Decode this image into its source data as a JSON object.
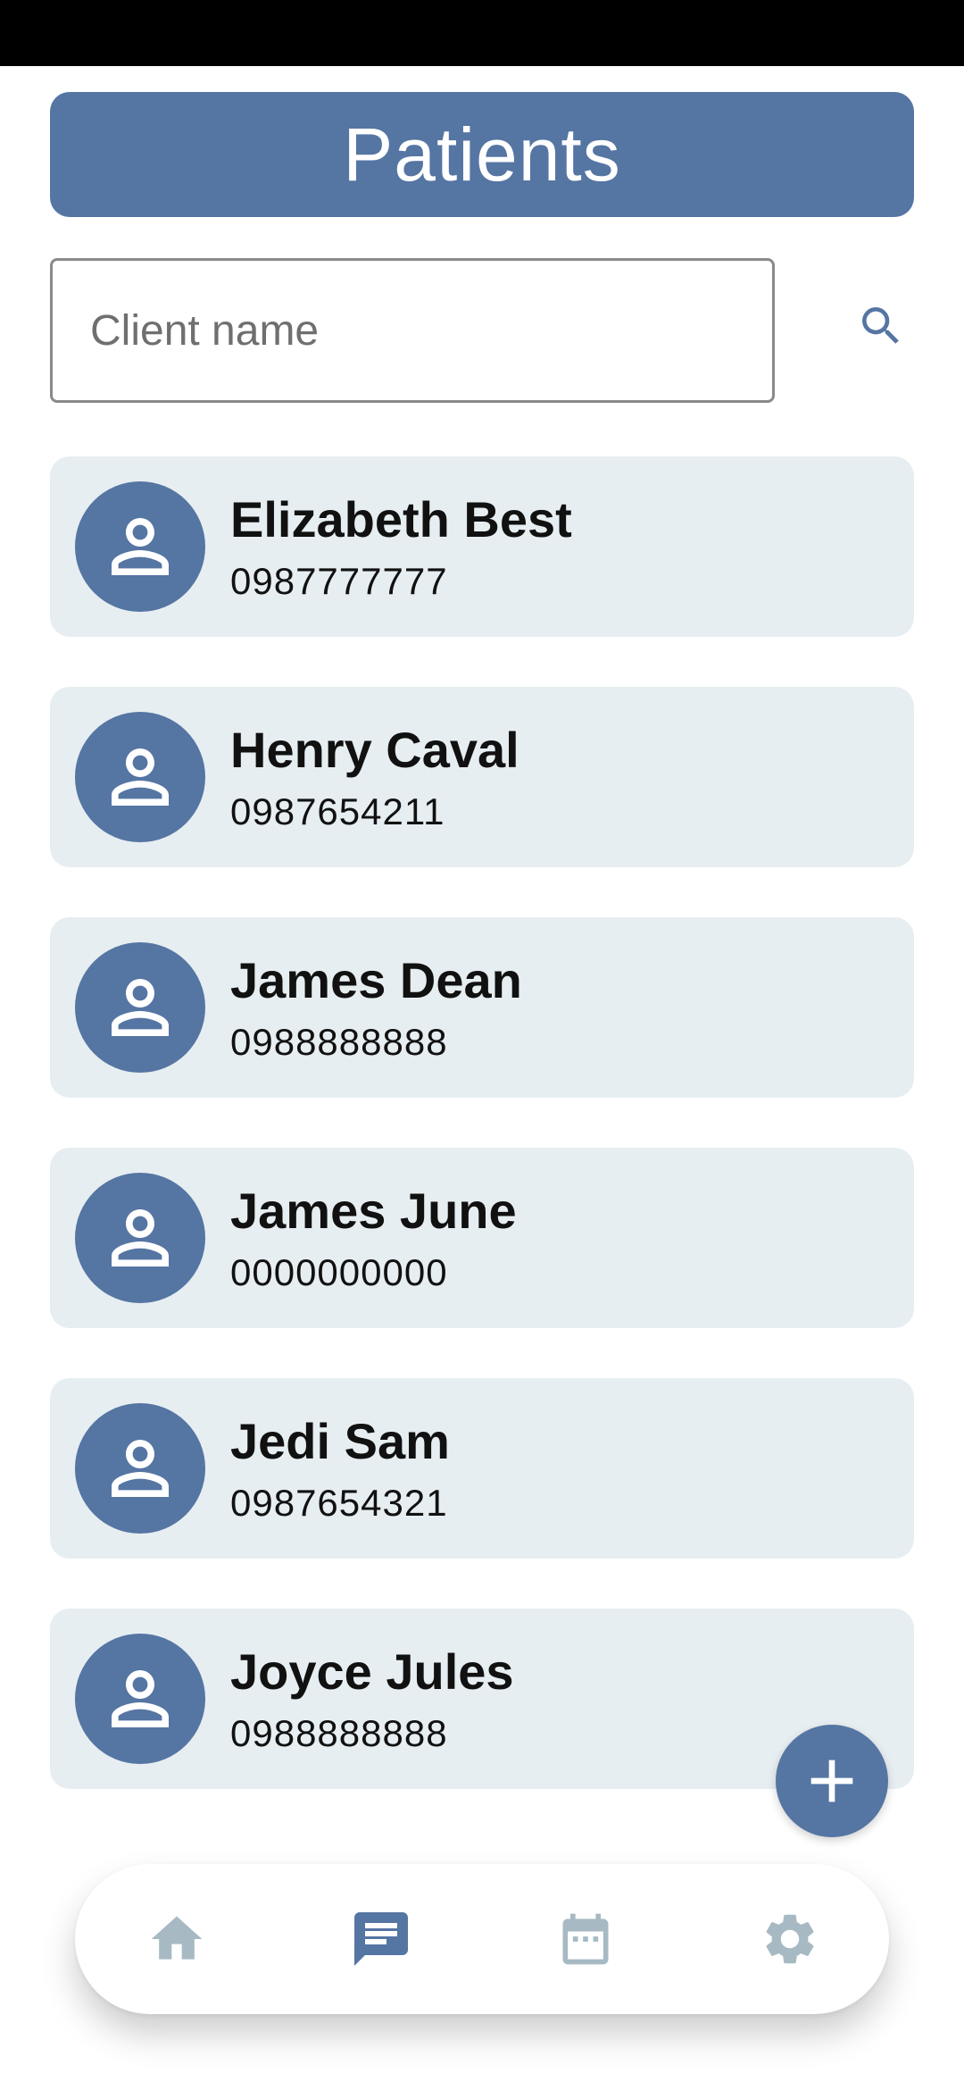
{
  "header": {
    "title": "Patients"
  },
  "search": {
    "placeholder": "Client name",
    "value": ""
  },
  "patients": [
    {
      "name": "Elizabeth Best",
      "phone": "0987777777"
    },
    {
      "name": "Henry Caval",
      "phone": "0987654211"
    },
    {
      "name": "James Dean",
      "phone": "0988888888"
    },
    {
      "name": "James June",
      "phone": "0000000000"
    },
    {
      "name": "Jedi Sam",
      "phone": "0987654321"
    },
    {
      "name": "Joyce Jules",
      "phone": "0988888888"
    }
  ],
  "fab": {
    "icon": "plus-icon"
  },
  "bottom_nav": {
    "items": [
      {
        "icon": "home-icon",
        "active": false
      },
      {
        "icon": "message-icon",
        "active": true
      },
      {
        "icon": "calendar-icon",
        "active": false
      },
      {
        "icon": "gear-icon",
        "active": false
      }
    ]
  },
  "colors": {
    "primary": "#5575a3",
    "card_background": "#e7eef1",
    "nav_inactive": "#a7bac4"
  }
}
